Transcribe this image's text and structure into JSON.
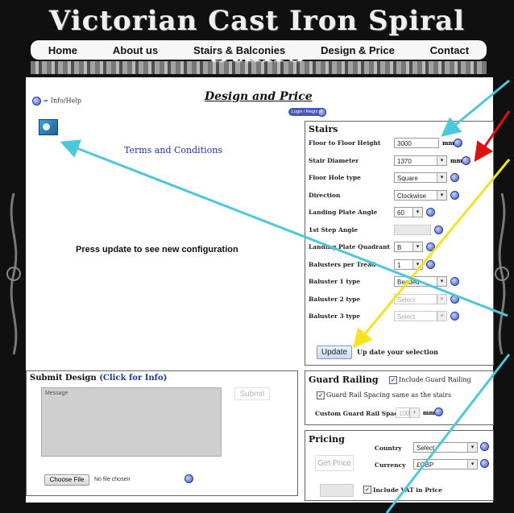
{
  "site_title": "Victorian Cast Iron Spiral Stairs",
  "nav": [
    {
      "label": "Home"
    },
    {
      "label": "About us"
    },
    {
      "label": "Stairs & Balconies"
    },
    {
      "label": "Design & Price"
    },
    {
      "label": "Contact"
    }
  ],
  "page_heading": "Design and Price",
  "info_help": "= Info/Help",
  "login_register": "Login / Register",
  "terms_link": "Terms and Conditions",
  "update_message": "Press update to see new configuration",
  "stairs": {
    "title": "Stairs",
    "fields": [
      {
        "label": "Floor to Floor Height",
        "value": "3000",
        "unit": "mm"
      },
      {
        "label": "Stair Diameter",
        "value": "1370",
        "unit": "mm"
      },
      {
        "label": "Floor Hole type",
        "value": "Square",
        "unit": ""
      },
      {
        "label": "Direction",
        "value": "Clockwise",
        "unit": ""
      },
      {
        "label": "Landing Plate Angle",
        "value": "60",
        "unit": ""
      },
      {
        "label": "1st Step Angle",
        "value": "",
        "unit": ""
      },
      {
        "label": "Landing Plate Quadrant",
        "value": "B",
        "unit": ""
      },
      {
        "label": "Balusters per Tread",
        "value": "1",
        "unit": ""
      },
      {
        "label": "Baluster 1 type",
        "value": "Beaded",
        "unit": ""
      },
      {
        "label": "Baluster 2 type",
        "value": "Select",
        "unit": ""
      },
      {
        "label": "Baluster 3 type",
        "value": "Select",
        "unit": ""
      }
    ],
    "update_button": "Update",
    "update_hint": "Up date your selection"
  },
  "submit": {
    "title": "Submit Design",
    "info_link": "(Click for Info)",
    "message_placeholder": "Message",
    "submit_button": "Submit",
    "choose_file": "Choose File",
    "file_status": "No file chosen"
  },
  "guard": {
    "title": "Guard Railing",
    "include_label": "Include Guard Railing",
    "same_spacing_label": "Guard Rail Spacing same as the stairs",
    "custom_label": "Custom Guard Rail Spacing",
    "custom_value": "100",
    "unit": "mm"
  },
  "pricing": {
    "title": "Pricing",
    "get_price": "Get Price",
    "country_label": "Country",
    "country_value": "Select",
    "currency_label": "Currency",
    "currency_value": "£GBP",
    "vat_label": "Include VAT in Price"
  },
  "colors": {
    "arrow_cyan": "#4cc8dc",
    "arrow_red": "#e01010",
    "arrow_yellow": "#f5e51c",
    "panel_border": "#666666",
    "link_blue": "#1a33b8"
  }
}
